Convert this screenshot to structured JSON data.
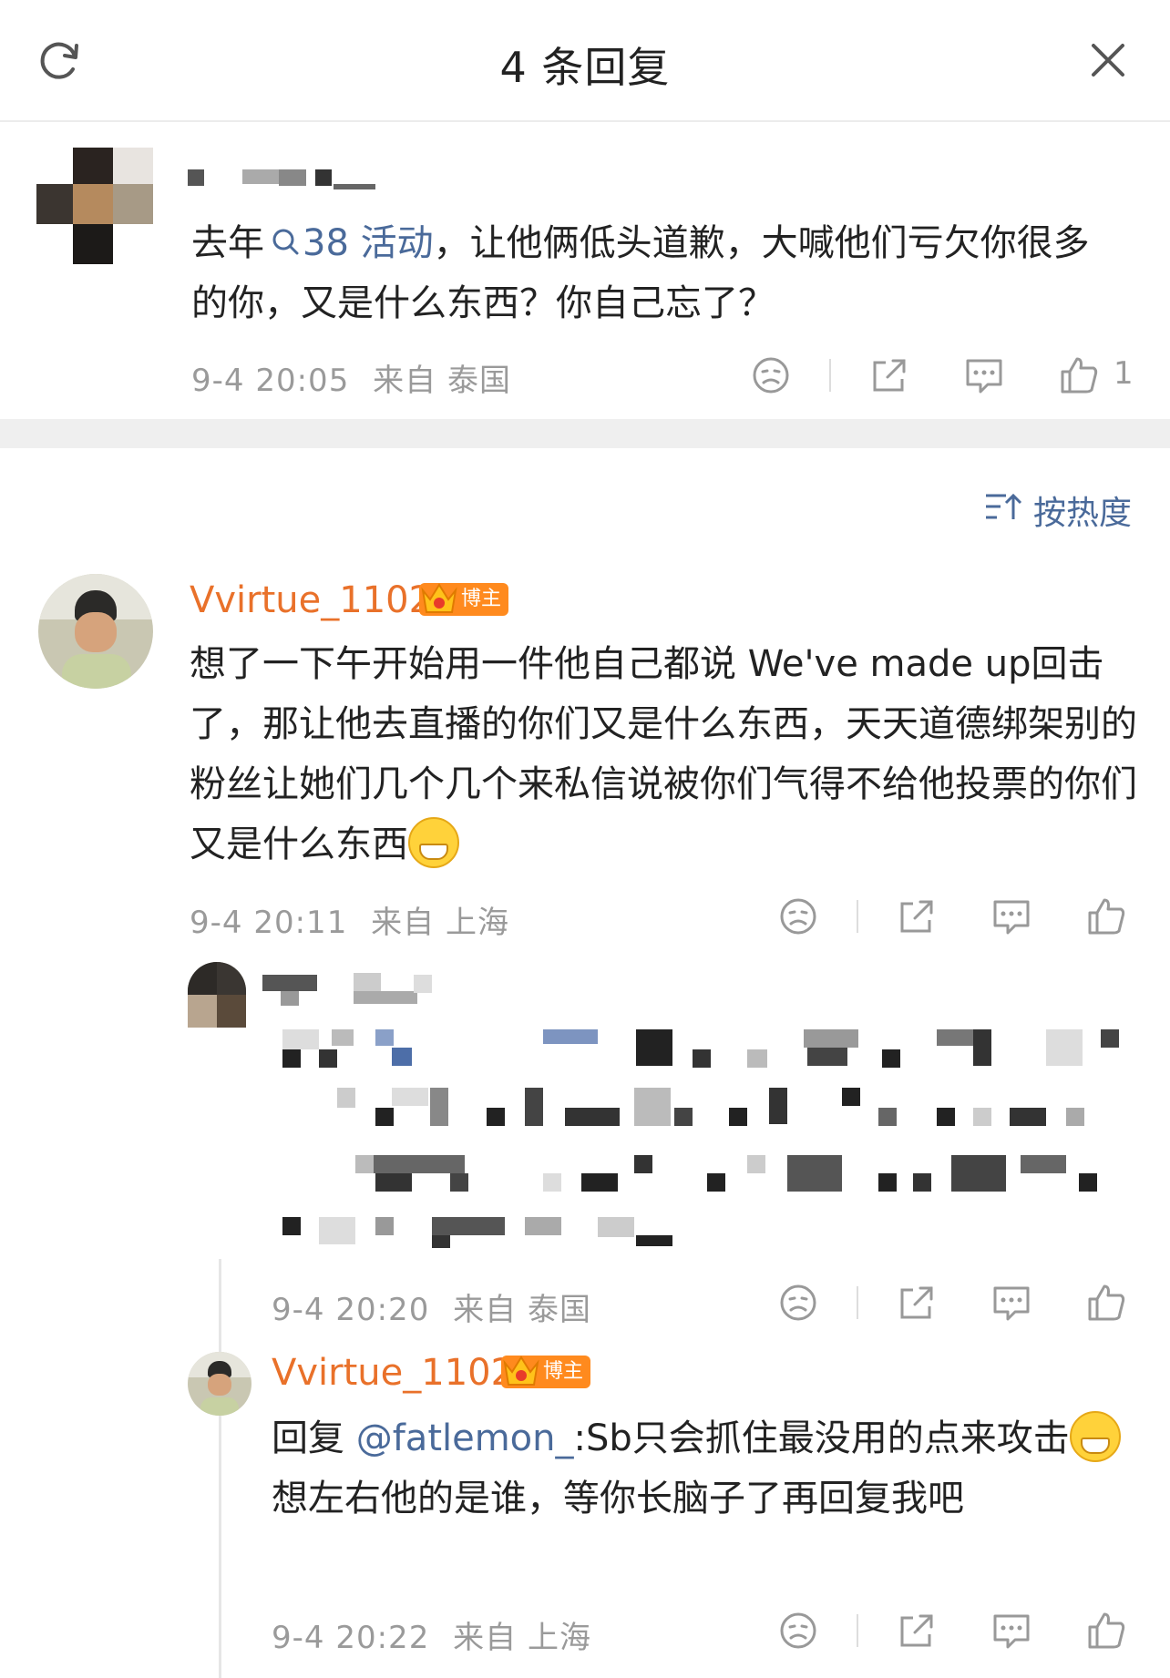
{
  "header": {
    "title": "4 条回复",
    "refresh_icon": "refresh-icon",
    "close_icon": "close-icon"
  },
  "root_comment": {
    "text_before_link": "去年",
    "link_text": "38 活动",
    "text_after_link": "，让他俩低头道歉，大喊他们亏欠你很多的你，又是什么东西？你自己忘了？",
    "timestamp": "9-4 20:05",
    "source": "来自 泰国",
    "like_count": "1"
  },
  "sort": {
    "label": "按热度"
  },
  "reply1": {
    "username": "Vvirtue_1102",
    "badge": "博主",
    "text": "想了一下午开始用一件他自己都说 We've made up回击了，那让他去直播的你们又是什么东西，天天道德绑架别的粉丝让她们几个几个来私信说被你们气得不给他投票的你们又是什么东西",
    "timestamp": "9-4 20:11",
    "source": "来自 上海"
  },
  "reply2": {
    "timestamp": "9-4 20:20",
    "source": "来自 泰国"
  },
  "reply3": {
    "username": "Vvirtue_1102",
    "badge": "博主",
    "reply_prefix": "回复",
    "mention": "@fatlemon_",
    "text_a": ":Sb只会抓住最没用的点来攻击",
    "text_b": "想左右他的是谁，等你长脑子了再回复我吧",
    "timestamp": "9-4 20:22",
    "source": "来自 上海"
  },
  "colors": {
    "username": "#e9712a",
    "link": "#4a6a9a",
    "meta_gray": "#9a9a9a",
    "badge_orange": "#ff8a1e"
  }
}
